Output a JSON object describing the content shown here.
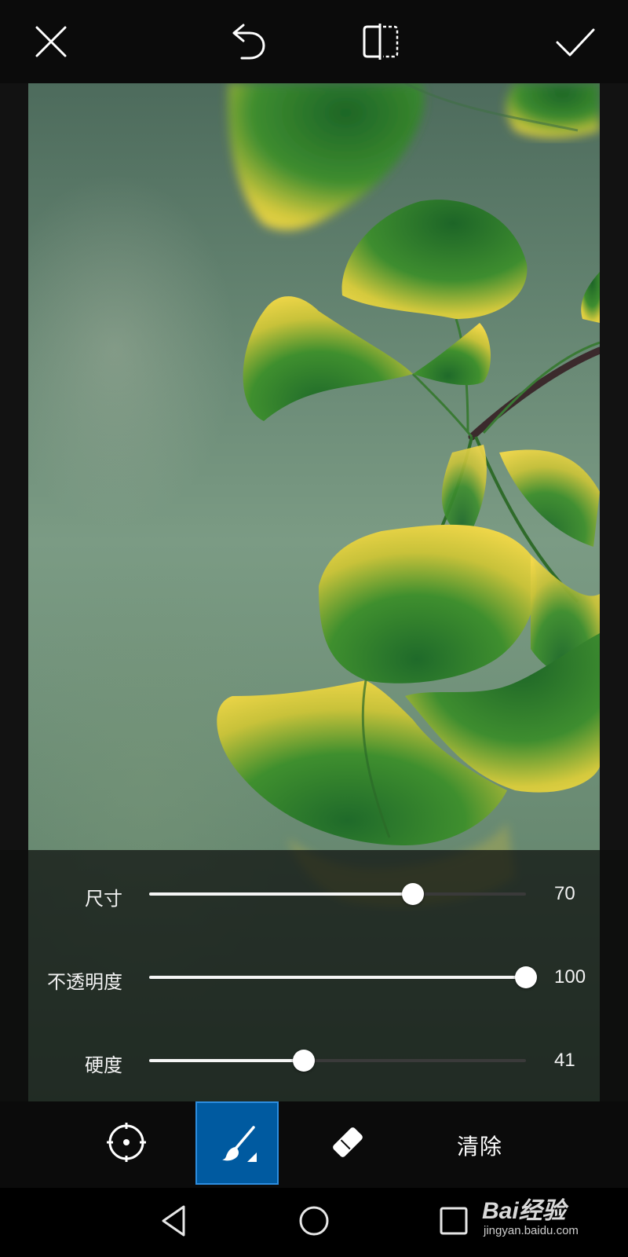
{
  "toolbar": {
    "close_icon": "close-icon",
    "undo_icon": "undo-icon",
    "compare_icon": "compare-icon",
    "confirm_icon": "check-icon"
  },
  "brush_settings": {
    "size": {
      "label": "尺寸",
      "value": "70",
      "fraction": 0.7
    },
    "opacity": {
      "label": "不透明度",
      "value": "100",
      "fraction": 1.0
    },
    "hardness": {
      "label": "硬度",
      "value": "41",
      "fraction": 0.41
    }
  },
  "tools": {
    "items": [
      {
        "name": "target-icon",
        "active": false
      },
      {
        "name": "brush-icon",
        "active": true
      },
      {
        "name": "eraser-icon",
        "active": false
      }
    ],
    "clear_label": "清除",
    "active_color": "#005aa0"
  },
  "navigation": {
    "back_icon": "back-triangle-icon",
    "home_icon": "home-circle-icon",
    "recents_icon": "recents-square-icon"
  },
  "watermark": {
    "brand": "Bai经验",
    "url": "jingyan.baidu.com"
  }
}
